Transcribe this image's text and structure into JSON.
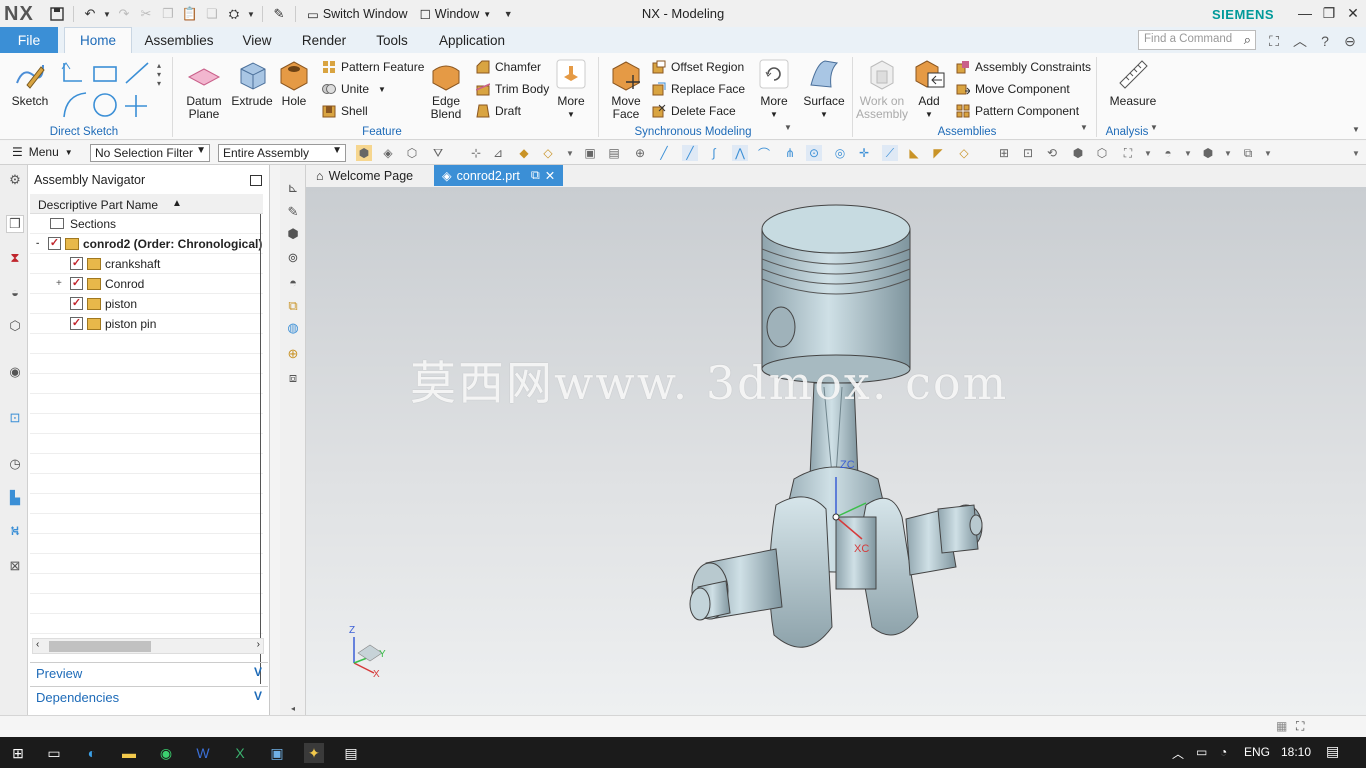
{
  "titlebar": {
    "logo": "NX",
    "switch_window": "Switch Window",
    "window": "Window",
    "app_title": "NX - Modeling",
    "brand": "SIEMENS"
  },
  "tabs": {
    "file": "File",
    "items": [
      "Home",
      "Assemblies",
      "View",
      "Render",
      "Tools",
      "Application"
    ],
    "active": "Home",
    "find_placeholder": "Find a Command"
  },
  "ribbon": {
    "direct_sketch": {
      "label": "Direct Sketch",
      "sketch": "Sketch"
    },
    "feature": {
      "label": "Feature",
      "datum_plane": [
        "Datum",
        "Plane"
      ],
      "extrude": "Extrude",
      "hole": "Hole",
      "pattern_feature": "Pattern Feature",
      "unite": "Unite",
      "shell": "Shell",
      "edge_blend": [
        "Edge",
        "Blend"
      ],
      "chamfer": "Chamfer",
      "trim_body": "Trim Body",
      "draft": "Draft",
      "more": "More"
    },
    "sync": {
      "label": "Synchronous Modeling",
      "move_face": [
        "Move",
        "Face"
      ],
      "offset_region": "Offset Region",
      "replace_face": "Replace Face",
      "delete_face": "Delete Face",
      "more": "More",
      "surface": "Surface"
    },
    "assemblies": {
      "label": "Assemblies",
      "work_on_assembly": [
        "Work on",
        "Assembly"
      ],
      "add": "Add",
      "assembly_constraints": "Assembly Constraints",
      "move_component": "Move Component",
      "pattern_component": "Pattern Component"
    },
    "analysis": {
      "label": "Analysis",
      "measure": "Measure"
    }
  },
  "toolbar2": {
    "menu": "Menu",
    "selection_filter": "No Selection Filter",
    "scope": "Entire Assembly"
  },
  "navigator": {
    "title": "Assembly Navigator",
    "column": "Descriptive Part Name",
    "rows": [
      {
        "label": "Sections",
        "level": 0
      },
      {
        "label": "conrod2 (Order: Chronological)",
        "level": 0
      },
      {
        "label": "crankshaft",
        "level": 1
      },
      {
        "label": "Conrod",
        "level": 1
      },
      {
        "label": "piston",
        "level": 1
      },
      {
        "label": "piston pin",
        "level": 1
      }
    ],
    "preview": "Preview",
    "dependencies": "Dependencies"
  },
  "viewtabs": {
    "welcome": "Welcome Page",
    "part": "conrod2.prt"
  },
  "viewport": {
    "watermark": "莫西网www. 3dmox. com",
    "triad": {
      "z": "Z",
      "y": "Y",
      "x": "X"
    },
    "wcs": {
      "zc": "ZC",
      "xc": "XC"
    }
  },
  "taskbar": {
    "lang": "ENG",
    "time": "18:10"
  },
  "colors": {
    "accent": "#3b8fd6",
    "label_blue": "#1e6bb8",
    "brand": "#009999",
    "model": "#b9ccd4"
  }
}
